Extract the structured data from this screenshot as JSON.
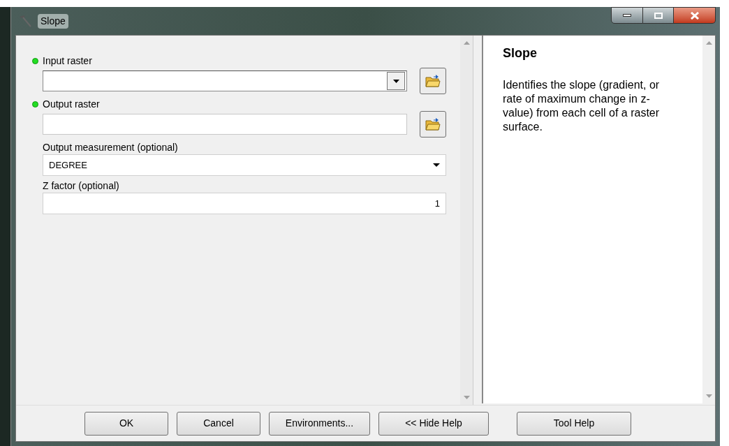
{
  "window": {
    "title": "Slope"
  },
  "parameters": [
    {
      "kind": "combo",
      "label": "Input raster",
      "required": true,
      "browse": true
    },
    {
      "kind": "text",
      "label": "Output raster",
      "required": true,
      "browse": true
    },
    {
      "kind": "select",
      "label": "Output measurement (optional)",
      "required": false,
      "value": "DEGREE",
      "browse": false
    },
    {
      "kind": "number",
      "label": "Z factor (optional)",
      "required": false,
      "value": "1",
      "browse": false
    }
  ],
  "help": {
    "title": "Slope",
    "body": "Identifies the slope (gradient, or rate of maximum change in z-value) from each cell of a raster surface."
  },
  "buttons": [
    {
      "label": "OK"
    },
    {
      "label": "Cancel"
    },
    {
      "label": "Environments..."
    },
    {
      "label": "<< Hide Help"
    },
    {
      "label": "Tool Help"
    }
  ]
}
